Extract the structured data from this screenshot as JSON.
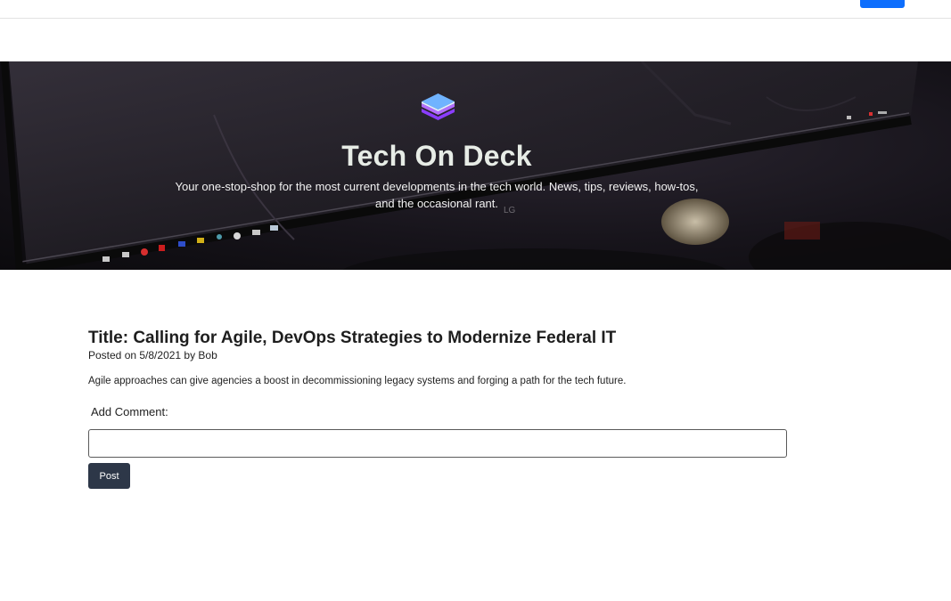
{
  "hero": {
    "title": "Tech On Deck",
    "tagline": "Your one-stop-shop for the most current developments in the tech world. News, tips, reviews, how-tos, and the occasional rant.",
    "monitor_brand": "LG"
  },
  "post": {
    "title": "Title: Calling for Agile, DevOps Strategies to Modernize Federal IT",
    "meta": "Posted on 5/8/2021 by Bob",
    "body": "Agile approaches can give agencies a boost in decommissioning legacy systems and forging a path for the tech future."
  },
  "comment": {
    "label": "Add Comment:",
    "value": "",
    "submit_label": "Post"
  },
  "colors": {
    "nav_button": "#0d6efd",
    "post_button": "#2d3748",
    "logo_top": "#6fb3ff",
    "logo_bottom": "#8b3dff"
  }
}
